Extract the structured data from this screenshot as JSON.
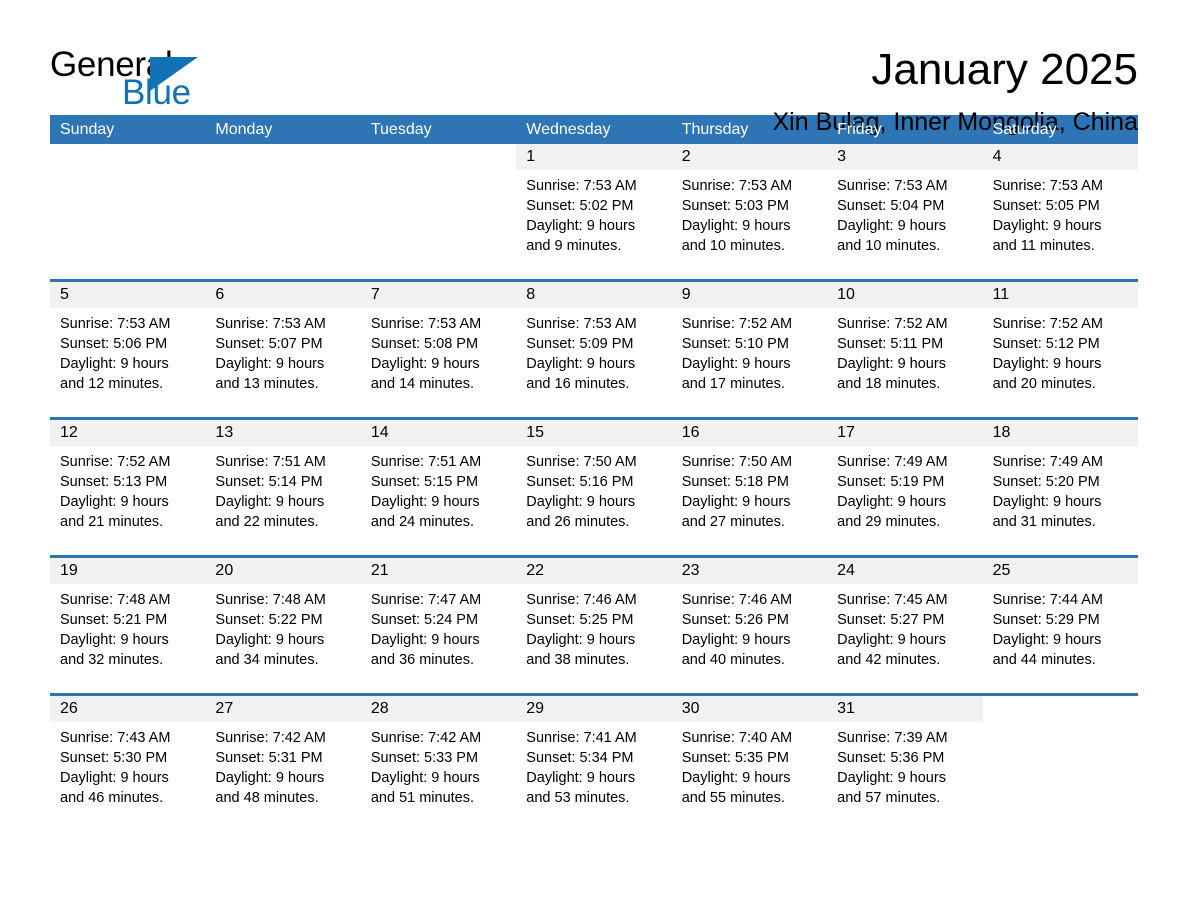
{
  "brand": {
    "name_part1": "General",
    "name_part2": "Blue"
  },
  "header": {
    "month_title": "January 2025",
    "location": "Xin Bulag, Inner Mongolia, China"
  },
  "theme": {
    "header_blue": "#2e75b6",
    "daynum_gray": "#f1f1f1",
    "logo_blue": "#1272b6",
    "text_black": "#000000"
  },
  "weekdays": [
    "Sunday",
    "Monday",
    "Tuesday",
    "Wednesday",
    "Thursday",
    "Friday",
    "Saturday"
  ],
  "weeks": [
    [
      {
        "day": "",
        "sunrise": "",
        "sunset": "",
        "daylight1": "",
        "daylight2": "",
        "blank": true
      },
      {
        "day": "",
        "sunrise": "",
        "sunset": "",
        "daylight1": "",
        "daylight2": "",
        "blank": true
      },
      {
        "day": "",
        "sunrise": "",
        "sunset": "",
        "daylight1": "",
        "daylight2": "",
        "blank": true
      },
      {
        "day": "1",
        "sunrise": "Sunrise: 7:53 AM",
        "sunset": "Sunset: 5:02 PM",
        "daylight1": "Daylight: 9 hours",
        "daylight2": "and 9 minutes."
      },
      {
        "day": "2",
        "sunrise": "Sunrise: 7:53 AM",
        "sunset": "Sunset: 5:03 PM",
        "daylight1": "Daylight: 9 hours",
        "daylight2": "and 10 minutes."
      },
      {
        "day": "3",
        "sunrise": "Sunrise: 7:53 AM",
        "sunset": "Sunset: 5:04 PM",
        "daylight1": "Daylight: 9 hours",
        "daylight2": "and 10 minutes."
      },
      {
        "day": "4",
        "sunrise": "Sunrise: 7:53 AM",
        "sunset": "Sunset: 5:05 PM",
        "daylight1": "Daylight: 9 hours",
        "daylight2": "and 11 minutes."
      }
    ],
    [
      {
        "day": "5",
        "sunrise": "Sunrise: 7:53 AM",
        "sunset": "Sunset: 5:06 PM",
        "daylight1": "Daylight: 9 hours",
        "daylight2": "and 12 minutes."
      },
      {
        "day": "6",
        "sunrise": "Sunrise: 7:53 AM",
        "sunset": "Sunset: 5:07 PM",
        "daylight1": "Daylight: 9 hours",
        "daylight2": "and 13 minutes."
      },
      {
        "day": "7",
        "sunrise": "Sunrise: 7:53 AM",
        "sunset": "Sunset: 5:08 PM",
        "daylight1": "Daylight: 9 hours",
        "daylight2": "and 14 minutes."
      },
      {
        "day": "8",
        "sunrise": "Sunrise: 7:53 AM",
        "sunset": "Sunset: 5:09 PM",
        "daylight1": "Daylight: 9 hours",
        "daylight2": "and 16 minutes."
      },
      {
        "day": "9",
        "sunrise": "Sunrise: 7:52 AM",
        "sunset": "Sunset: 5:10 PM",
        "daylight1": "Daylight: 9 hours",
        "daylight2": "and 17 minutes."
      },
      {
        "day": "10",
        "sunrise": "Sunrise: 7:52 AM",
        "sunset": "Sunset: 5:11 PM",
        "daylight1": "Daylight: 9 hours",
        "daylight2": "and 18 minutes."
      },
      {
        "day": "11",
        "sunrise": "Sunrise: 7:52 AM",
        "sunset": "Sunset: 5:12 PM",
        "daylight1": "Daylight: 9 hours",
        "daylight2": "and 20 minutes."
      }
    ],
    [
      {
        "day": "12",
        "sunrise": "Sunrise: 7:52 AM",
        "sunset": "Sunset: 5:13 PM",
        "daylight1": "Daylight: 9 hours",
        "daylight2": "and 21 minutes."
      },
      {
        "day": "13",
        "sunrise": "Sunrise: 7:51 AM",
        "sunset": "Sunset: 5:14 PM",
        "daylight1": "Daylight: 9 hours",
        "daylight2": "and 22 minutes."
      },
      {
        "day": "14",
        "sunrise": "Sunrise: 7:51 AM",
        "sunset": "Sunset: 5:15 PM",
        "daylight1": "Daylight: 9 hours",
        "daylight2": "and 24 minutes."
      },
      {
        "day": "15",
        "sunrise": "Sunrise: 7:50 AM",
        "sunset": "Sunset: 5:16 PM",
        "daylight1": "Daylight: 9 hours",
        "daylight2": "and 26 minutes."
      },
      {
        "day": "16",
        "sunrise": "Sunrise: 7:50 AM",
        "sunset": "Sunset: 5:18 PM",
        "daylight1": "Daylight: 9 hours",
        "daylight2": "and 27 minutes."
      },
      {
        "day": "17",
        "sunrise": "Sunrise: 7:49 AM",
        "sunset": "Sunset: 5:19 PM",
        "daylight1": "Daylight: 9 hours",
        "daylight2": "and 29 minutes."
      },
      {
        "day": "18",
        "sunrise": "Sunrise: 7:49 AM",
        "sunset": "Sunset: 5:20 PM",
        "daylight1": "Daylight: 9 hours",
        "daylight2": "and 31 minutes."
      }
    ],
    [
      {
        "day": "19",
        "sunrise": "Sunrise: 7:48 AM",
        "sunset": "Sunset: 5:21 PM",
        "daylight1": "Daylight: 9 hours",
        "daylight2": "and 32 minutes."
      },
      {
        "day": "20",
        "sunrise": "Sunrise: 7:48 AM",
        "sunset": "Sunset: 5:22 PM",
        "daylight1": "Daylight: 9 hours",
        "daylight2": "and 34 minutes."
      },
      {
        "day": "21",
        "sunrise": "Sunrise: 7:47 AM",
        "sunset": "Sunset: 5:24 PM",
        "daylight1": "Daylight: 9 hours",
        "daylight2": "and 36 minutes."
      },
      {
        "day": "22",
        "sunrise": "Sunrise: 7:46 AM",
        "sunset": "Sunset: 5:25 PM",
        "daylight1": "Daylight: 9 hours",
        "daylight2": "and 38 minutes."
      },
      {
        "day": "23",
        "sunrise": "Sunrise: 7:46 AM",
        "sunset": "Sunset: 5:26 PM",
        "daylight1": "Daylight: 9 hours",
        "daylight2": "and 40 minutes."
      },
      {
        "day": "24",
        "sunrise": "Sunrise: 7:45 AM",
        "sunset": "Sunset: 5:27 PM",
        "daylight1": "Daylight: 9 hours",
        "daylight2": "and 42 minutes."
      },
      {
        "day": "25",
        "sunrise": "Sunrise: 7:44 AM",
        "sunset": "Sunset: 5:29 PM",
        "daylight1": "Daylight: 9 hours",
        "daylight2": "and 44 minutes."
      }
    ],
    [
      {
        "day": "26",
        "sunrise": "Sunrise: 7:43 AM",
        "sunset": "Sunset: 5:30 PM",
        "daylight1": "Daylight: 9 hours",
        "daylight2": "and 46 minutes."
      },
      {
        "day": "27",
        "sunrise": "Sunrise: 7:42 AM",
        "sunset": "Sunset: 5:31 PM",
        "daylight1": "Daylight: 9 hours",
        "daylight2": "and 48 minutes."
      },
      {
        "day": "28",
        "sunrise": "Sunrise: 7:42 AM",
        "sunset": "Sunset: 5:33 PM",
        "daylight1": "Daylight: 9 hours",
        "daylight2": "and 51 minutes."
      },
      {
        "day": "29",
        "sunrise": "Sunrise: 7:41 AM",
        "sunset": "Sunset: 5:34 PM",
        "daylight1": "Daylight: 9 hours",
        "daylight2": "and 53 minutes."
      },
      {
        "day": "30",
        "sunrise": "Sunrise: 7:40 AM",
        "sunset": "Sunset: 5:35 PM",
        "daylight1": "Daylight: 9 hours",
        "daylight2": "and 55 minutes."
      },
      {
        "day": "31",
        "sunrise": "Sunrise: 7:39 AM",
        "sunset": "Sunset: 5:36 PM",
        "daylight1": "Daylight: 9 hours",
        "daylight2": "and 57 minutes."
      },
      {
        "day": "",
        "sunrise": "",
        "sunset": "",
        "daylight1": "",
        "daylight2": "",
        "blank": true
      }
    ]
  ]
}
